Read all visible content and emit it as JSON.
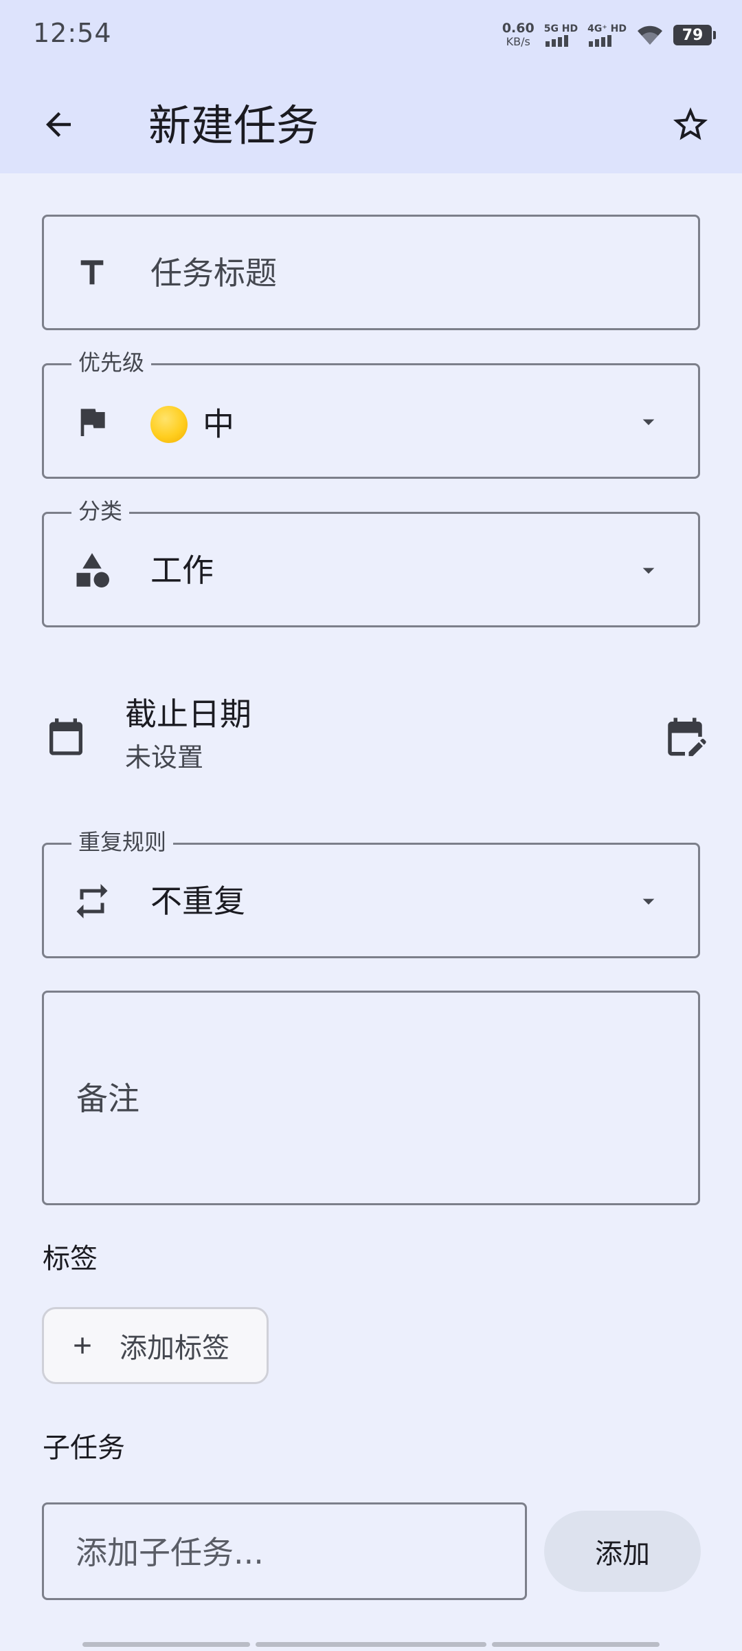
{
  "status_bar": {
    "time": "12:54",
    "net_speed": "0.60",
    "net_unit": "KB/s",
    "sim1_label": "5G HD",
    "sim2_label": "4G⁺ HD",
    "battery": "79"
  },
  "app_bar": {
    "title": "新建任务",
    "back_icon": "arrow-back-icon",
    "favorite_icon": "star-outline-icon"
  },
  "form": {
    "title_placeholder": "任务标题",
    "priority": {
      "label": "优先级",
      "value": "中",
      "emoji_color": "#FFCE1F"
    },
    "category": {
      "label": "分类",
      "value": "工作"
    },
    "due_date": {
      "title": "截止日期",
      "value": "未设置"
    },
    "repeat": {
      "label": "重复规则",
      "value": "不重复"
    },
    "notes_placeholder": "备注"
  },
  "tags": {
    "section_title": "标签",
    "add_button": "添加标签"
  },
  "subtasks": {
    "section_title": "子任务",
    "input_placeholder": "添加子任务...",
    "add_button": "添加"
  },
  "colors": {
    "background": "#ECEFFC",
    "app_bar": "#DDE3FC",
    "outline": "#7C7F8A"
  }
}
